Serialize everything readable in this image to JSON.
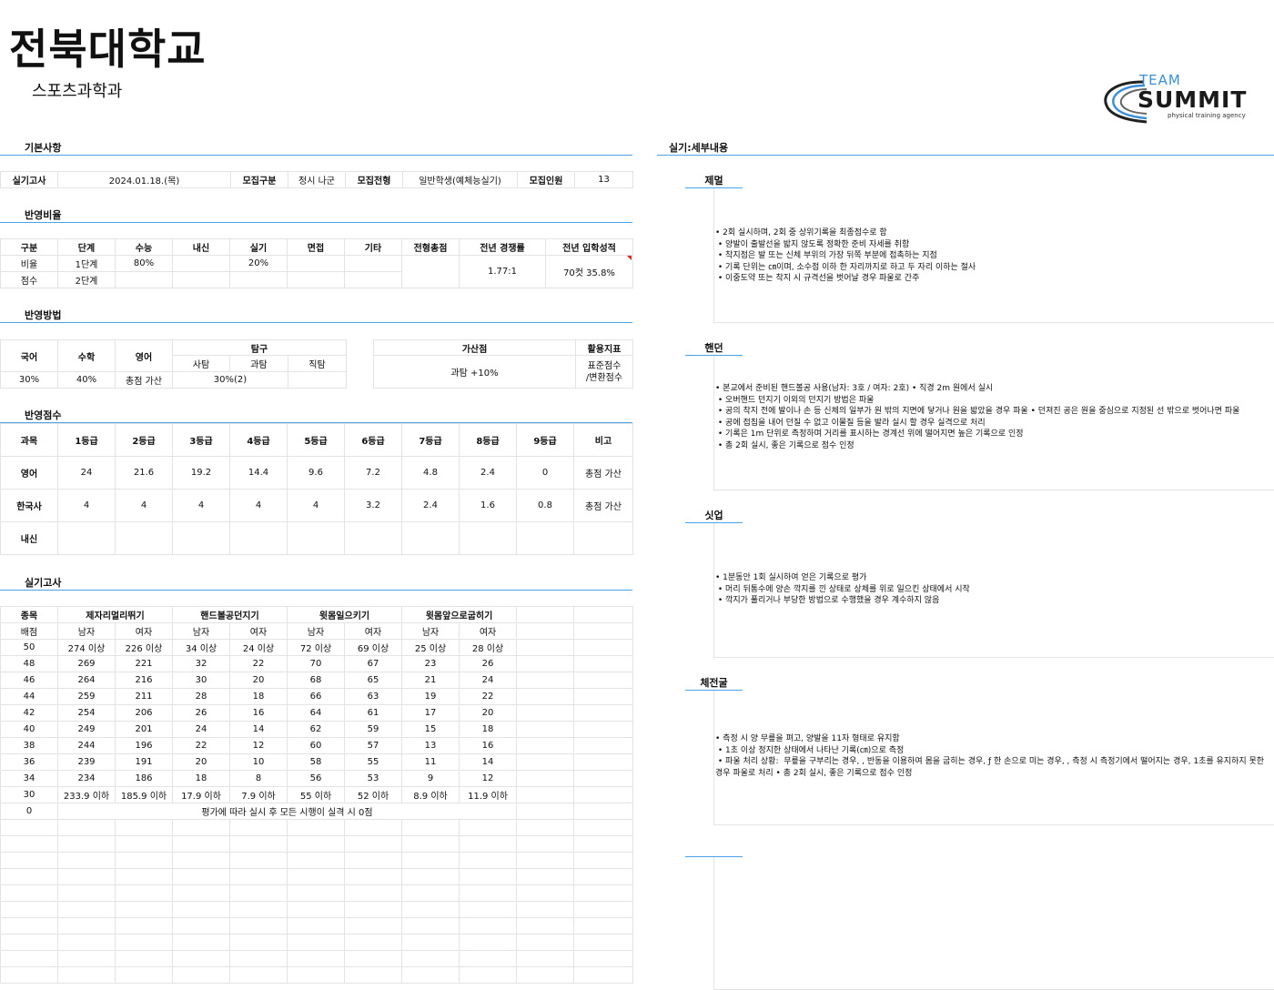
{
  "header": {
    "university": "전북대학교",
    "department": "스포츠과학과"
  },
  "logo": {
    "line1": "TEAM",
    "line2": "SUMMIT",
    "tagline": "physical training agency"
  },
  "basic": {
    "section_title": "기본사항",
    "exam_label": "실기고사",
    "exam_date": "2024.01.18.(목)",
    "recruit_type_label": "모집구분",
    "recruit_type": "정시 나군",
    "admission_label": "모집전형",
    "admission": "일반학생(예체능실기)",
    "quota_label": "모집인원",
    "quota": "13"
  },
  "ratio": {
    "section_title": "반영비율",
    "headers": [
      "구분",
      "단계",
      "수능",
      "내신",
      "실기",
      "면접",
      "기타",
      "전형총점",
      "전년 경쟁률",
      "전년 입학성적"
    ],
    "row1": [
      "비율",
      "1단계",
      "80%",
      "",
      "20%",
      "",
      ""
    ],
    "row2": [
      "점수",
      "2단계",
      "",
      "",
      "",
      "",
      ""
    ],
    "total": "",
    "competition": "1.77:1",
    "prev_result": "70컷 35.8%"
  },
  "method": {
    "section_title": "반영방법",
    "korean": "국어",
    "math": "수학",
    "english": "영어",
    "inquiry": "탐구",
    "social": "사탐",
    "science": "과탐",
    "vocational": "직탐",
    "korean_v": "30%",
    "math_v": "40%",
    "english_v": "총점 가산",
    "inquiry_v": "30%(2)",
    "bonus_label": "가산점",
    "bonus_v": "과탐 +10%",
    "index_label": "활용지표",
    "index_v1": "표준점수",
    "index_v2": "/변환점수"
  },
  "score": {
    "section_title": "반영점수",
    "headers": [
      "과목",
      "1등급",
      "2등급",
      "3등급",
      "4등급",
      "5등급",
      "6등급",
      "7등급",
      "8등급",
      "9등급",
      "비고"
    ],
    "rows": [
      [
        "영어",
        "24",
        "21.6",
        "19.2",
        "14.4",
        "9.6",
        "7.2",
        "4.8",
        "2.4",
        "0",
        "총점 가산"
      ],
      [
        "한국사",
        "4",
        "4",
        "4",
        "4",
        "4",
        "3.2",
        "2.4",
        "1.6",
        "0.8",
        "총점 가산"
      ],
      [
        "내신",
        "",
        "",
        "",
        "",
        "",
        "",
        "",
        "",
        "",
        ""
      ]
    ]
  },
  "practical": {
    "section_title": "실기고사",
    "events_label": "종목",
    "events": [
      "제자리멀리뛰기",
      "핸드볼공던지기",
      "윗몸일으키기",
      "윗몸앞으로굽히기"
    ],
    "sub": [
      "배점",
      "남자",
      "여자",
      "남자",
      "여자",
      "남자",
      "여자",
      "남자",
      "여자"
    ],
    "rows": [
      [
        "50",
        "274 이상",
        "226 이상",
        "34 이상",
        "24 이상",
        "72 이상",
        "69 이상",
        "25 이상",
        "28 이상"
      ],
      [
        "48",
        "269",
        "221",
        "32",
        "22",
        "70",
        "67",
        "23",
        "26"
      ],
      [
        "46",
        "264",
        "216",
        "30",
        "20",
        "68",
        "65",
        "21",
        "24"
      ],
      [
        "44",
        "259",
        "211",
        "28",
        "18",
        "66",
        "63",
        "19",
        "22"
      ],
      [
        "42",
        "254",
        "206",
        "26",
        "16",
        "64",
        "61",
        "17",
        "20"
      ],
      [
        "40",
        "249",
        "201",
        "24",
        "14",
        "62",
        "59",
        "15",
        "18"
      ],
      [
        "38",
        "244",
        "196",
        "22",
        "12",
        "60",
        "57",
        "13",
        "16"
      ],
      [
        "36",
        "239",
        "191",
        "20",
        "10",
        "58",
        "55",
        "11",
        "14"
      ],
      [
        "34",
        "234",
        "186",
        "18",
        "8",
        "56",
        "53",
        "9",
        "12"
      ],
      [
        "30",
        "233.9 이하",
        "185.9 이하",
        "17.9 이하",
        "7.9 이하",
        "55 이하",
        "52 이하",
        "8.9 이하",
        "11.9 이하"
      ]
    ],
    "zero_score": "0",
    "zero_note": "평가에 따라 실시 후 모든 시행이 실격 시 0점"
  },
  "details": {
    "section_title": "실기:세부내용",
    "items": [
      {
        "title": "제멀",
        "text": "• 2회 실시하며, 2회 중 상위기록을 최종점수로 함\n • 양발이 출발선을 밟지 않도록 정확한 준비 자세를 취함\n • 착지점은 발 또는 신체 부위의 가장 뒤쪽 부분에 접촉하는 지점\n • 기록 단위는 ㎝이며, 소수점 이하 한 자리까지로 하고 두 자리 이하는 절사\n • 이중도약 또는 착지 시 규격선을 벗어날 경우 파울로 간주"
      },
      {
        "title": "핸던",
        "text": "• 본교에서 준비된 핸드볼공 사용(남자: 3호 / 여자: 2호) • 직경 2m 원에서 실시\n • 오버핸드 던지기 이외의 던지기 방법은 파울\n • 공의 착지 전에 발이나 손 등 신체의 일부가 원 밖의 지면에 닿거나 원을 밟았을 경우 파울 • 던져진 공은 원을 중심으로 지정된 선 밖으로 벗어나면 파울\n • 공에 접칩을 내어 던질 수 없고 이물질 등을 발라 실시 할 경우 실격으로 처리\n • 기록은 1m 단위로 측정하며 거리를 표시하는 경계선 위에 떨어지면 높은 기록으로 인정\n • 총 2회 실시, 좋은 기록으로 점수 인정"
      },
      {
        "title": "싯업",
        "text": "• 1분동안 1회 실시하여 얻은 기록으로 평가\n • 머리 뒤통수에 양손 깍지를 낀 상태로 상체를 위로 일으킨 상태에서 시작\n • 깍지가 풀리거나 부당한 방법으로 수행했을 경우 계수하지 않음"
      },
      {
        "title": "체전굴",
        "text": "• 측정 시 양 무릎을 펴고, 양발을 11자 형태로 유지함\n • 1초 이상 정지한 상태에서 나타난 기록(㎝)으로 측정\n • 파울 처리 상황:  무릎을 구부리는 경우, , 반동을 이용하여 몸을 굽히는 경우, ƒ 한 손으로 미는 경우, , 측정 시 측정기에서 떨어지는 경우, 1초를 유지하지 못한 경우 파울로 처리 • 총 2회 실시, 좋은 기록으로 점수 인정"
      },
      {
        "title": "",
        "text": ""
      }
    ]
  }
}
